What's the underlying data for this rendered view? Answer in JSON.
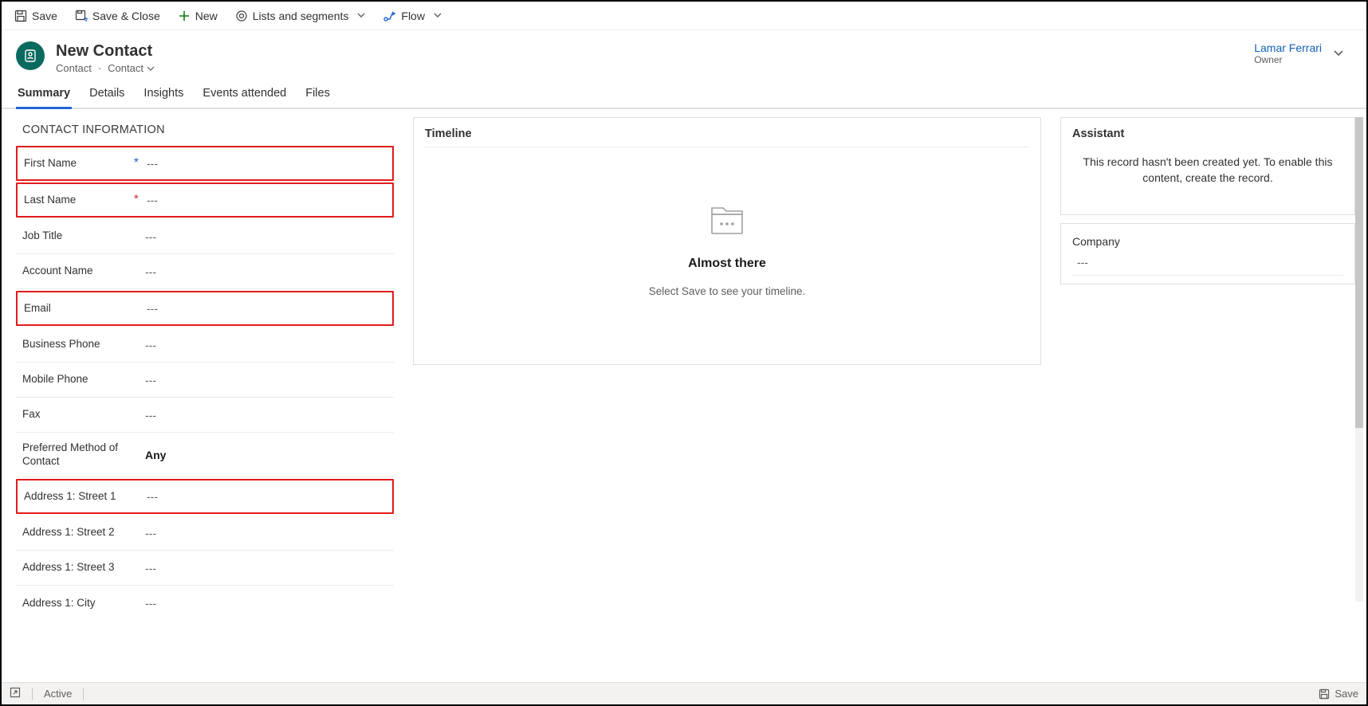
{
  "commands": {
    "save": "Save",
    "save_close": "Save & Close",
    "new": "New",
    "lists_segments": "Lists and segments",
    "flow": "Flow"
  },
  "header": {
    "title": "New Contact",
    "entity": "Contact",
    "form": "Contact",
    "owner_name": "Lamar Ferrari",
    "owner_label": "Owner"
  },
  "tabs": {
    "summary": "Summary",
    "details": "Details",
    "insights": "Insights",
    "events": "Events attended",
    "files": "Files"
  },
  "contact_section": {
    "title": "CONTACT INFORMATION",
    "fields": {
      "first_name": {
        "label": "First Name",
        "value": "---"
      },
      "last_name": {
        "label": "Last Name",
        "value": "---"
      },
      "job_title": {
        "label": "Job Title",
        "value": "---"
      },
      "account_name": {
        "label": "Account Name",
        "value": "---"
      },
      "email": {
        "label": "Email",
        "value": "---"
      },
      "business_phone": {
        "label": "Business Phone",
        "value": "---"
      },
      "mobile_phone": {
        "label": "Mobile Phone",
        "value": "---"
      },
      "fax": {
        "label": "Fax",
        "value": "---"
      },
      "pref_contact": {
        "label": "Preferred Method of Contact",
        "value": "Any"
      },
      "addr1_s1": {
        "label": "Address 1: Street 1",
        "value": "---"
      },
      "addr1_s2": {
        "label": "Address 1: Street 2",
        "value": "---"
      },
      "addr1_s3": {
        "label": "Address 1: Street 3",
        "value": "---"
      },
      "addr1_city": {
        "label": "Address 1: City",
        "value": "---"
      }
    }
  },
  "timeline": {
    "title": "Timeline",
    "heading": "Almost there",
    "subtext": "Select Save to see your timeline."
  },
  "assistant": {
    "title": "Assistant",
    "message": "This record hasn't been created yet. To enable this content, create the record."
  },
  "company_card": {
    "label": "Company",
    "value": "---"
  },
  "statusbar": {
    "status": "Active",
    "save": "Save"
  }
}
